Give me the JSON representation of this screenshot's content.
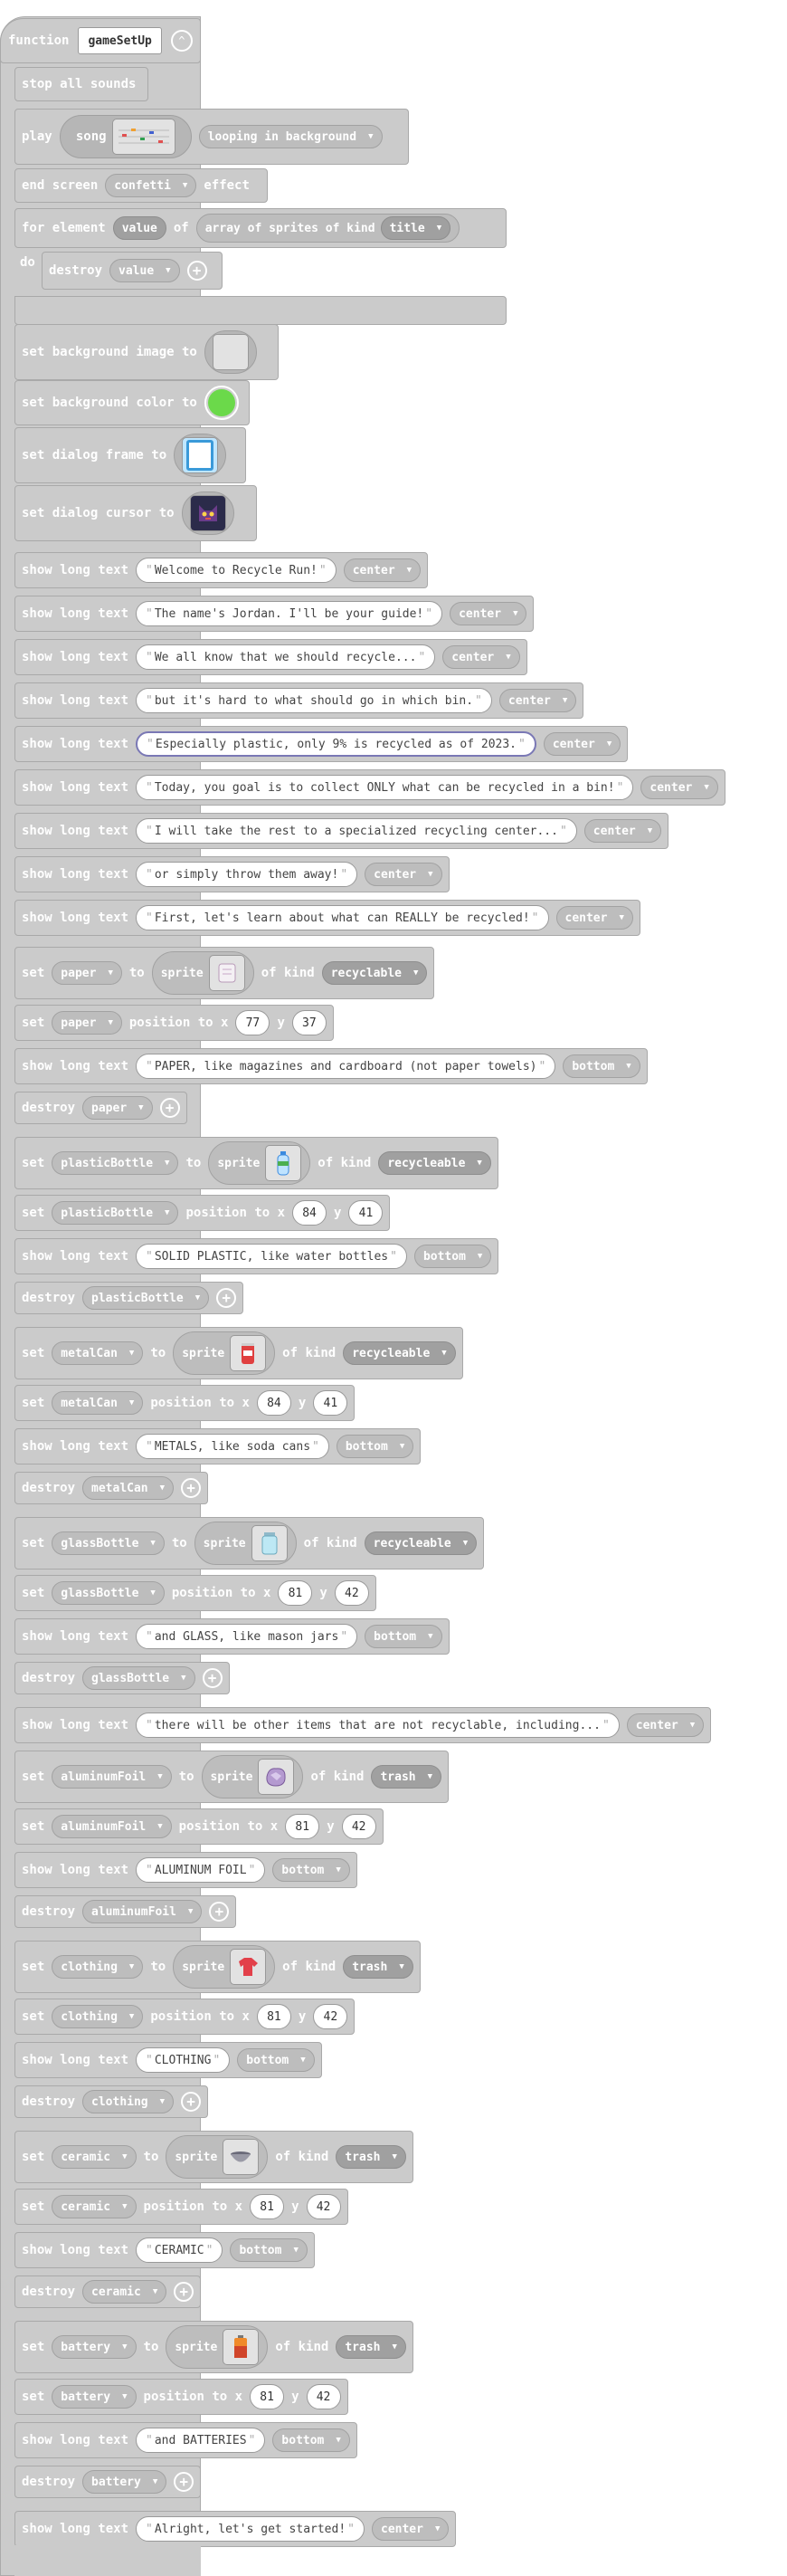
{
  "function": {
    "keyword": "function",
    "name": "gameSetUp"
  },
  "header": {
    "stop_sounds": "stop all sounds",
    "play": "play",
    "song": "song",
    "loop": "looping in background",
    "end_screen": "end screen",
    "effect": "confetti",
    "effect_suffix": "effect",
    "for_element": "for element",
    "value": "value",
    "of": "of",
    "array_label": "array of sprites of kind",
    "kind_title": "title",
    "do": "do",
    "destroy": "destroy"
  },
  "backgrounds": {
    "bg_image": "set background image to",
    "bg_color": "set background color to",
    "bg_color_value": "#6bd94a",
    "dialog_frame": "set dialog frame to",
    "dialog_cursor": "set dialog cursor to"
  },
  "labels": {
    "show_long_text": "show long text",
    "set": "set",
    "to": "to",
    "sprite": "sprite",
    "of_kind": "of kind",
    "position_to_x": "position to x",
    "y": "y",
    "destroy": "destroy"
  },
  "intro_texts": [
    {
      "text": "Welcome to Recycle Run!",
      "pos": "center"
    },
    {
      "text": "The name's Jordan. I'll be your guide!",
      "pos": "center"
    },
    {
      "text": "We all know that we should recycle...",
      "pos": "center"
    },
    {
      "text": "but it's hard to what should go in which bin.",
      "pos": "center"
    },
    {
      "text": "Especially plastic, only 9% is recycled as of 2023.",
      "pos": "center"
    },
    {
      "text": "Today, you goal is to collect ONLY what can be recycled in a bin!",
      "pos": "center"
    },
    {
      "text": "I will take the rest to a specialized recycling center...",
      "pos": "center"
    },
    {
      "text": "or simply throw them away!",
      "pos": "center"
    },
    {
      "text": "First, let's learn about what can REALLY be recycled!",
      "pos": "center"
    }
  ],
  "items": [
    {
      "var": "paper",
      "kind": "recyclable",
      "x": "77",
      "y": "37",
      "text": "PAPER, like magazines and cardboard (not paper towels)",
      "pos": "bottom",
      "icon": "paper-sprite-icon"
    },
    {
      "var": "plasticBottle",
      "kind": "recycleable",
      "x": "84",
      "y": "41",
      "text": "SOLID PLASTIC, like water bottles",
      "pos": "bottom",
      "icon": "plastic-bottle-sprite-icon"
    },
    {
      "var": "metalCan",
      "kind": "recycleable",
      "x": "84",
      "y": "41",
      "text": "METALS, like soda cans",
      "pos": "bottom",
      "icon": "soda-can-sprite-icon"
    },
    {
      "var": "glassBottle",
      "kind": "recycleable",
      "x": "81",
      "y": "42",
      "text": "and GLASS, like mason jars",
      "pos": "bottom",
      "icon": "glass-jar-sprite-icon"
    }
  ],
  "trash_intro": {
    "text": "there will be other items that are not recyclable, including...",
    "pos": "center"
  },
  "trash_items": [
    {
      "var": "aluminumFoil",
      "kind": "trash",
      "x": "81",
      "y": "42",
      "text": "ALUMINUM FOIL",
      "pos": "bottom",
      "icon": "aluminum-foil-sprite-icon"
    },
    {
      "var": "clothing",
      "kind": "trash",
      "x": "81",
      "y": "42",
      "text": "CLOTHING",
      "pos": "bottom",
      "icon": "clothing-sprite-icon"
    },
    {
      "var": "ceramic",
      "kind": "trash",
      "x": "81",
      "y": "42",
      "text": "CERAMIC",
      "pos": "bottom",
      "icon": "ceramic-bowl-sprite-icon"
    },
    {
      "var": "battery",
      "kind": "trash",
      "x": "81",
      "y": "42",
      "text": "and BATTERIES",
      "pos": "bottom",
      "icon": "battery-sprite-icon"
    }
  ],
  "final_text": {
    "text": "Alright, let's get started!",
    "pos": "center"
  }
}
